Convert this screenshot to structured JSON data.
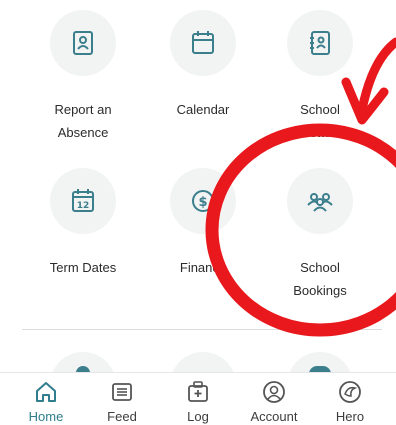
{
  "grid": [
    {
      "label": "Report an\nAbsence",
      "icon": "id-card-icon"
    },
    {
      "label": "Calendar",
      "icon": "calendar-icon"
    },
    {
      "label": "School\nDetails",
      "icon": "contact-book-icon"
    },
    {
      "label": "Term Dates",
      "icon": "calendar-12-icon"
    },
    {
      "label": "Finance",
      "icon": "coin-icon"
    },
    {
      "label": "School\nBookings",
      "icon": "group-icon"
    }
  ],
  "tabbar": [
    {
      "label": "Home",
      "icon": "home-icon",
      "active": true
    },
    {
      "label": "Feed",
      "icon": "feed-icon",
      "active": false
    },
    {
      "label": "Log",
      "icon": "log-icon",
      "active": false
    },
    {
      "label": "Account",
      "icon": "account-icon",
      "active": false
    },
    {
      "label": "Hero",
      "icon": "hero-icon",
      "active": false
    }
  ],
  "colors": {
    "accent": "#2f7d8d",
    "icon": "#3b7f8c",
    "annotation": "#e8181c"
  }
}
